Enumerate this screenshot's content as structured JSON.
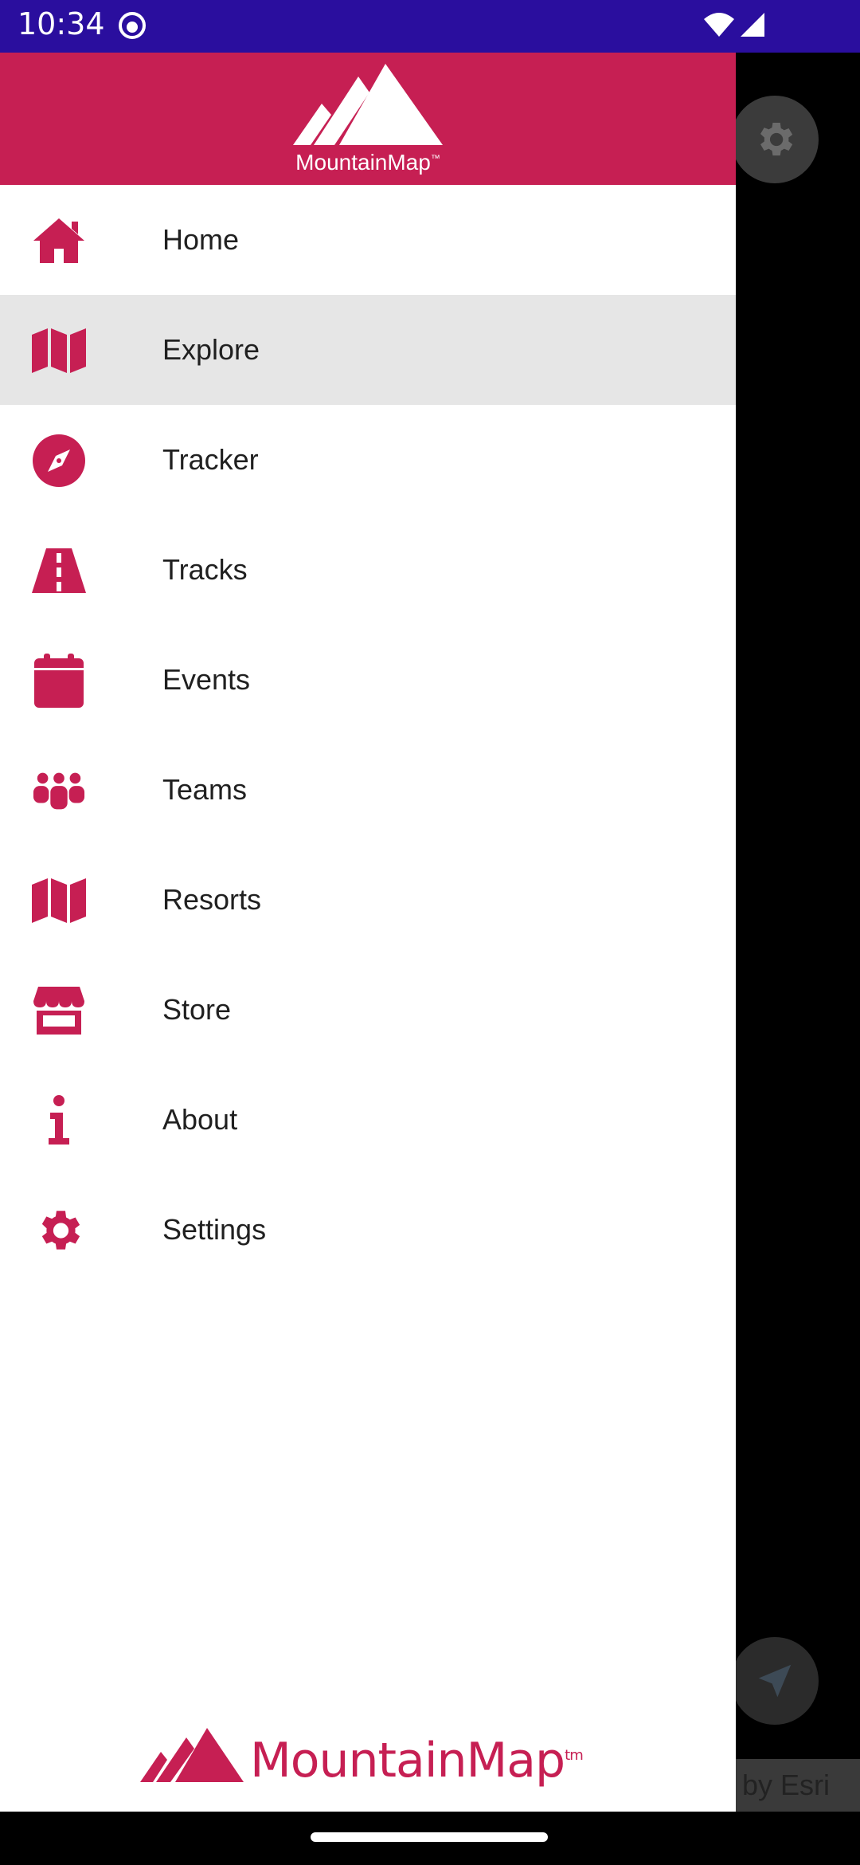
{
  "status_bar": {
    "time": "10:34"
  },
  "header": {
    "logo_text": "MountainMap",
    "logo_mark": "™"
  },
  "menu": {
    "items": [
      {
        "label": "Home",
        "icon": "home-icon",
        "active": false
      },
      {
        "label": "Explore",
        "icon": "map-icon",
        "active": true
      },
      {
        "label": "Tracker",
        "icon": "compass-icon",
        "active": false
      },
      {
        "label": "Tracks",
        "icon": "road-icon",
        "active": false
      },
      {
        "label": "Events",
        "icon": "calendar-icon",
        "active": false
      },
      {
        "label": "Teams",
        "icon": "people-icon",
        "active": false
      },
      {
        "label": "Resorts",
        "icon": "map-icon",
        "active": false
      },
      {
        "label": "Store",
        "icon": "store-icon",
        "active": false
      },
      {
        "label": "About",
        "icon": "info-icon",
        "active": false
      },
      {
        "label": "Settings",
        "icon": "gear-icon",
        "active": false
      }
    ]
  },
  "footer": {
    "logo_text": "MountainMap",
    "logo_mark": "tm"
  },
  "map": {
    "attribution": "by Esri"
  },
  "colors": {
    "brand": "#c61f53",
    "status_bar": "#2a0e9e",
    "active_row": "#e6e6e6"
  }
}
